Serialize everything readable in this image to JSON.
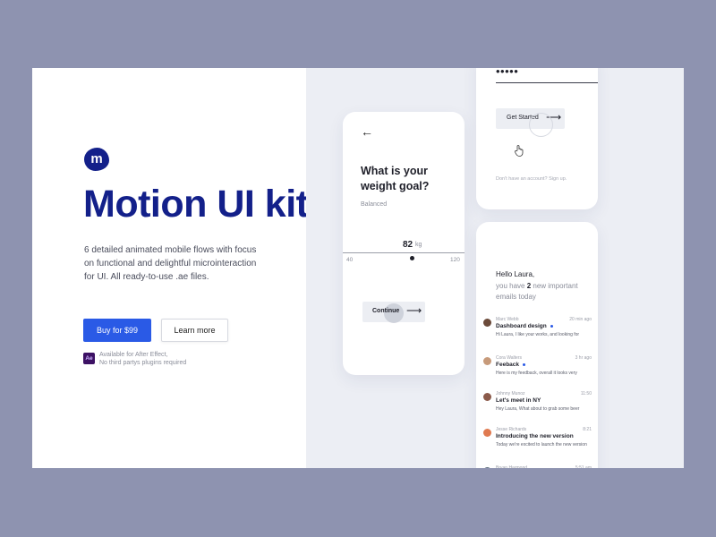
{
  "brand": {
    "logo_letter": "m",
    "logo_color": "#13208a"
  },
  "hero": {
    "title": "Motion UI kit",
    "description": "6 detailed animated mobile flows with focus on functional and delightful microinteraction for UI.  All ready-to-use .ae files.",
    "buy_button": "Buy for $99",
    "learn_button": "Learn more",
    "ae_badge": "Ae",
    "ae_line1": "Available for After Effect,",
    "ae_line2": "No third partys plugins required",
    "accent_color": "#2a5ae6"
  },
  "weight_screen": {
    "back_icon": "arrow-left-icon",
    "question": "What is your weight goal?",
    "subtitle": "Balanced",
    "value": "82",
    "unit": "kg",
    "min": "40",
    "max": "120",
    "continue_label": "Continue"
  },
  "login_screen": {
    "password_mask": "•••••",
    "get_started_label": "Get Started",
    "signup_text": "Don't have an account? Sign up."
  },
  "inbox_screen": {
    "greeting_hello": "Hello Laura,",
    "greeting_pre": "you have ",
    "greeting_count": "2",
    "greeting_post": " new important emails today",
    "mails": [
      {
        "sender": "Marc Webb",
        "time": "20 min ago",
        "subject": "Dashboard design",
        "preview": "Hi Laura, I like your works, and looking for",
        "unread": true,
        "avatar_color": "#6b4a3a"
      },
      {
        "sender": "Cora Walters",
        "time": "3 hr ago",
        "subject": "Feeback",
        "preview": "Here is my feedback, overall it looks very",
        "unread": true,
        "avatar_color": "#c79a7a"
      },
      {
        "sender": "Johnny Munoz",
        "time": "11:50",
        "subject": "Let's meet in NY",
        "preview": "Hey Laura, What about to grab some beer",
        "unread": false,
        "avatar_color": "#8b5a4a"
      },
      {
        "sender": "Jesse Richards",
        "time": "8:21",
        "subject": "Introducing the new version",
        "preview": "Today we're excited to launch the new version",
        "unread": false,
        "avatar_color": "#e07a50"
      },
      {
        "sender": "Bryan Harmond",
        "time": "5:51 am",
        "subject": "",
        "preview": "",
        "unread": false,
        "avatar_color": "#5a6a7a"
      }
    ]
  }
}
